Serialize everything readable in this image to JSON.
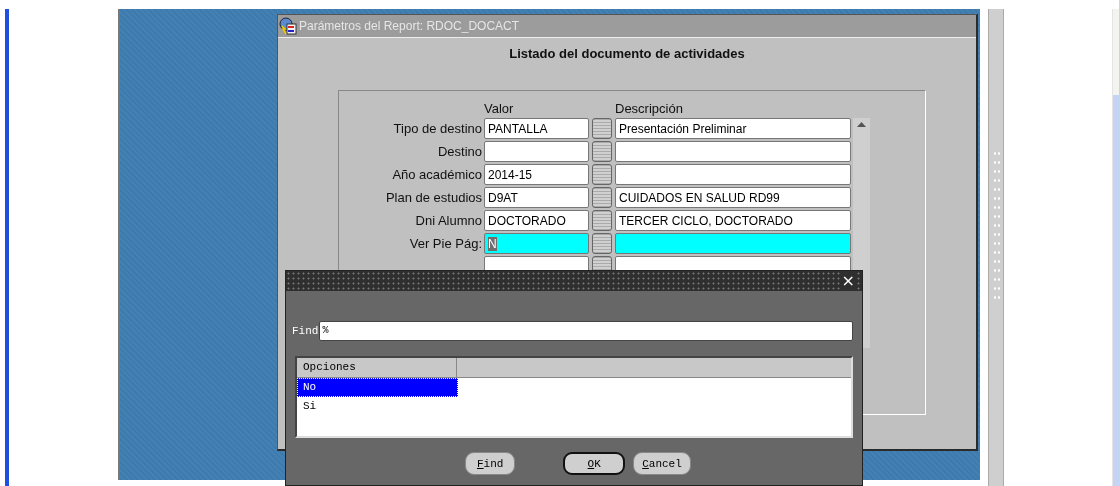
{
  "window": {
    "title": "Parámetros del Report: RDOC_DOCACT"
  },
  "heading": "Listado del documento de actividades",
  "columns": {
    "value": "Valor",
    "description": "Descripción"
  },
  "params": [
    {
      "label": "Tipo de destino",
      "value": "PANTALLA",
      "description": "Presentación Preliminar",
      "focused": false
    },
    {
      "label": "Destino",
      "focused": false
    },
    {
      "label": "Año académico",
      "value": "2014-15",
      "focused": false
    },
    {
      "label": "Plan de estudios",
      "value": "D9AT",
      "description": "CUIDADOS EN SALUD RD99",
      "focused": false
    },
    {
      "label": "Dni Alumno",
      "value": "DOCTORADO",
      "description": "TERCER CICLO, DOCTORADO",
      "focused": false
    },
    {
      "label": "Ver Pie Pág:",
      "value": "N",
      "focused": true
    }
  ],
  "lov_dialog": {
    "close": "×",
    "find_label": "Find",
    "find_value": "%",
    "column": "Opciones",
    "options": [
      {
        "label": "No",
        "selected": true
      },
      {
        "label": "Si",
        "selected": false
      }
    ],
    "buttons": [
      {
        "label": "Find",
        "default": false
      },
      {
        "label": "OK",
        "default": true
      },
      {
        "label": "Cancel",
        "default": false
      }
    ]
  }
}
